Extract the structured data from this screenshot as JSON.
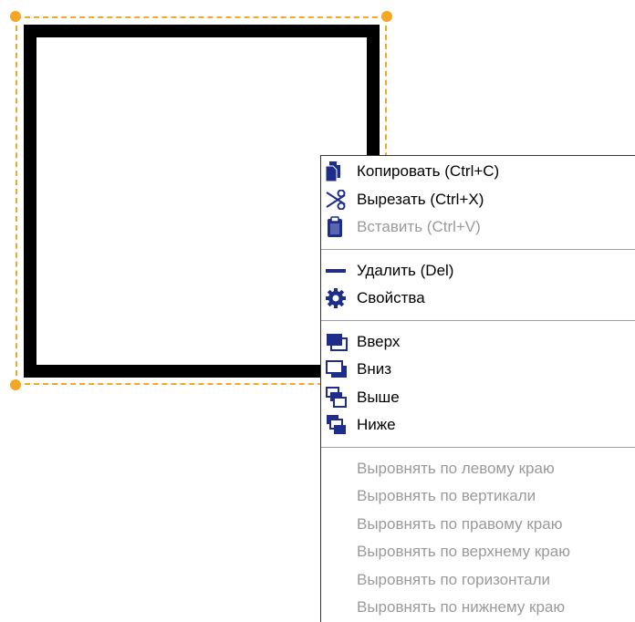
{
  "colors": {
    "selection": "#f5a623",
    "shape_stroke": "#000000",
    "icon": "#1e2c8c",
    "disabled_text": "#9a9a9a"
  },
  "context_menu": {
    "clipboard": [
      {
        "label": "Копировать (Ctrl+C)",
        "icon": "copy-icon",
        "enabled": true
      },
      {
        "label": "Вырезать (Ctrl+X)",
        "icon": "scissors-icon",
        "enabled": true
      },
      {
        "label": "Вставить (Ctrl+V)",
        "icon": "clipboard-icon",
        "enabled": false
      }
    ],
    "edit": [
      {
        "label": "Удалить (Del)",
        "icon": "minus-icon",
        "enabled": true
      },
      {
        "label": "Свойства",
        "icon": "gear-icon",
        "enabled": true
      }
    ],
    "order": [
      {
        "label": "Вверх",
        "icon": "bring-to-front-icon",
        "enabled": true
      },
      {
        "label": "Вниз",
        "icon": "send-to-back-icon",
        "enabled": true
      },
      {
        "label": "Выше",
        "icon": "bring-forward-icon",
        "enabled": true
      },
      {
        "label": "Ниже",
        "icon": "send-backward-icon",
        "enabled": true
      }
    ],
    "align": [
      {
        "label": "Выровнять по левому краю",
        "enabled": false
      },
      {
        "label": "Выровнять по вертикали",
        "enabled": false
      },
      {
        "label": "Выровнять по правому краю",
        "enabled": false
      },
      {
        "label": "Выровнять по верхнему краю",
        "enabled": false
      },
      {
        "label": "Выровнять по горизонтали",
        "enabled": false
      },
      {
        "label": "Выровнять по нижнему краю",
        "enabled": false
      }
    ]
  }
}
